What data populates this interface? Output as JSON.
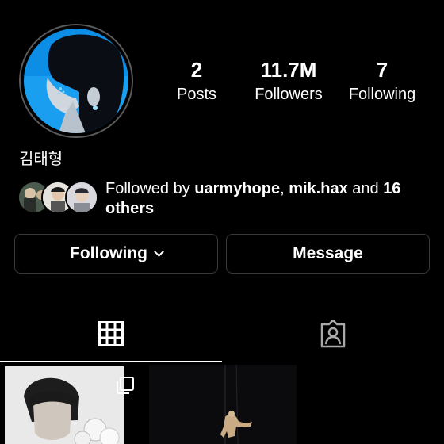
{
  "profile": {
    "name": "김태형",
    "stats": [
      {
        "value": "2",
        "label": "Posts"
      },
      {
        "value": "11.7M",
        "label": "Followers"
      },
      {
        "value": "7",
        "label": "Following"
      }
    ]
  },
  "followed_by": {
    "prefix": "Followed by ",
    "user1": "uarmyhope",
    "sep": ", ",
    "user2": "mik.hax",
    "and": " and ",
    "others": "16 others"
  },
  "buttons": {
    "following_label": "Following",
    "message_label": "Message"
  },
  "tabs": [
    {
      "icon": "grid-icon",
      "active": true
    },
    {
      "icon": "tagged-person-icon",
      "active": false
    }
  ],
  "colors": {
    "background": "#000000",
    "avatar_bg": "#1aa0f0",
    "button_border": "#3a3a3a"
  }
}
